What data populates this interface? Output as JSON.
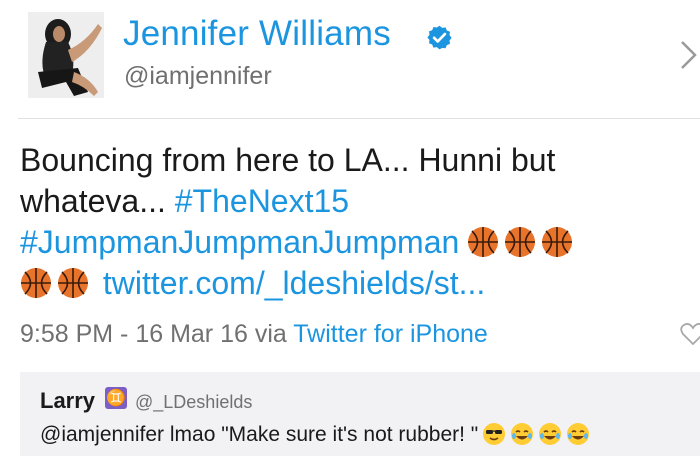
{
  "profile": {
    "display_name": "Jennifer Williams",
    "handle": "@iamjennifer",
    "verified": true,
    "avatar_icon": "profile-photo"
  },
  "tweet": {
    "line1": "Bouncing from here to LA... Hunni but",
    "line2_text": "whateva... ",
    "hashtag1": "#TheNext15",
    "hashtag2": "#JumpmanJumpmanJumpman",
    "link": "twitter.com/_ldeshields/st...",
    "emoji_icon": "basketball-icon",
    "timestamp": "9:58 PM - 16 Mar 16 via ",
    "source": "Twitter for iPhone"
  },
  "quoted_tweet": {
    "name": "Larry",
    "zodiac_glyph": "♊",
    "handle": "@_LDeshields",
    "text": "@iamjennifer lmao \"Make sure it's not rubber! \""
  },
  "colors": {
    "link_blue": "#1b95e0",
    "text": "#1a1a1a",
    "muted": "#707070",
    "basketball": "#e8742b"
  }
}
